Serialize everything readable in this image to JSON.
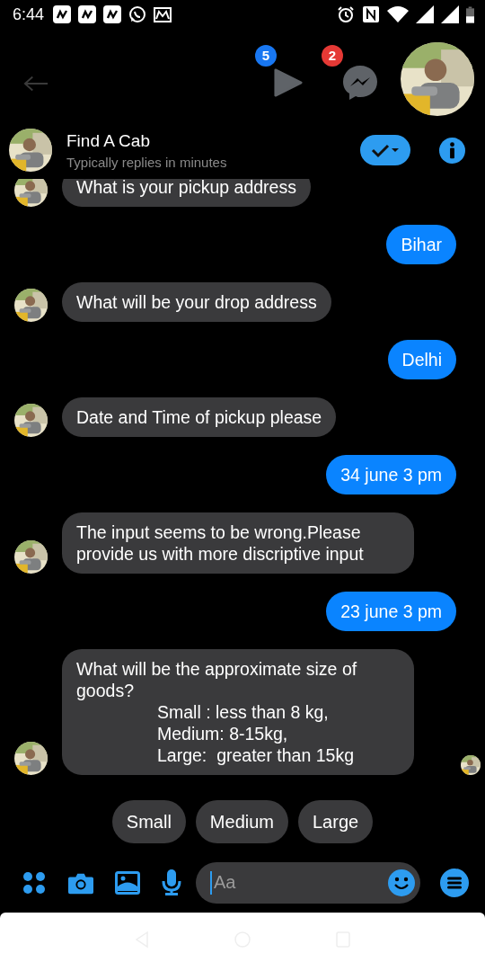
{
  "status_bar": {
    "time": "6:44"
  },
  "top_bar": {
    "video_badge": "5",
    "messenger_badge": "2"
  },
  "header": {
    "title": "Find A Cab",
    "subtitle": "Typically replies in minutes"
  },
  "messages": [
    {
      "kind": "incoming",
      "text": "What is your pickup address",
      "seen": false
    },
    {
      "kind": "outgoing",
      "text": "Bihar",
      "seen": false
    },
    {
      "kind": "incoming",
      "text": "What will be your drop address",
      "seen": false
    },
    {
      "kind": "outgoing",
      "text": "Delhi",
      "seen": false
    },
    {
      "kind": "incoming",
      "text": "Date and Time of pickup please",
      "seen": false
    },
    {
      "kind": "outgoing",
      "text": "34 june 3 pm",
      "seen": false
    },
    {
      "kind": "incoming",
      "text": "The input seems to be wrong.Please provide us with more discriptive input",
      "seen": false
    },
    {
      "kind": "outgoing",
      "text": "23 june 3 pm",
      "seen": false
    },
    {
      "kind": "incoming",
      "text": "What will be the approximate size of goods?",
      "items": [
        "Small : less than 8 kg,",
        "Medium: 8-15kg,",
        "Large:  greater than 15kg"
      ],
      "seen": true
    }
  ],
  "quick_replies": [
    "Small",
    "Medium",
    "Large"
  ],
  "composer": {
    "placeholder": "Aa"
  }
}
